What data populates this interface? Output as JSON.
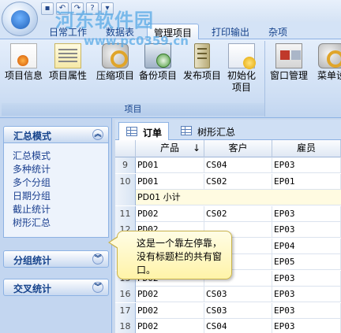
{
  "watermark": {
    "title": "河东软件园",
    "url": "www.pc0359.cn"
  },
  "ribbon_tabs": [
    {
      "label": "日常工作"
    },
    {
      "label": "数据表"
    },
    {
      "label": "管理项目"
    },
    {
      "label": "打印输出"
    },
    {
      "label": "杂项"
    }
  ],
  "ribbon_groups": [
    {
      "label": "项目"
    }
  ],
  "ribbon_buttons": [
    {
      "label": "项目信息",
      "icon": "certificate-icon"
    },
    {
      "label": "项目属性",
      "icon": "notepad-icon"
    },
    {
      "label": "压缩项目",
      "icon": "tools-icon"
    },
    {
      "label": "备份项目",
      "icon": "backup-disk-icon"
    },
    {
      "label": "发布项目",
      "icon": "server-icon"
    },
    {
      "label": "初始化项目",
      "icon": "initialize-icon"
    },
    {
      "label": "窗口管理",
      "icon": "window-icon"
    },
    {
      "label": "菜单设",
      "icon": "menu-settings-icon"
    }
  ],
  "nav": {
    "summary_header": "汇总模式",
    "summary_links": [
      "汇总模式",
      "多种统计",
      "多个分组",
      "日期分组",
      "截止统计",
      "树形汇总"
    ],
    "group_header": "分组统计",
    "cross_header": "交叉统计"
  },
  "doc_tabs": [
    {
      "label": "订单"
    },
    {
      "label": "树形汇总"
    }
  ],
  "grid": {
    "columns": [
      "产品",
      "客户",
      "雇员"
    ],
    "rows": [
      {
        "num": "9",
        "cells": [
          "PD01",
          "CS04",
          "EP03"
        ]
      },
      {
        "num": "10",
        "cells": [
          "PD01",
          "CS02",
          "EP01"
        ]
      },
      {
        "num": "",
        "subtotal": "PD01 小计"
      },
      {
        "num": "11",
        "cells": [
          "PD02",
          "CS02",
          "EP03"
        ]
      },
      {
        "num": "12",
        "cells": [
          "PD02",
          "",
          "EP03"
        ]
      },
      {
        "num": "13",
        "cells": [
          "PD02",
          "",
          "EP04"
        ]
      },
      {
        "num": "14",
        "cells": [
          "PD02",
          "",
          "EP05"
        ]
      },
      {
        "num": "15",
        "cells": [
          "PD02",
          "",
          "EP03"
        ]
      },
      {
        "num": "16",
        "cells": [
          "PD02",
          "CS03",
          "EP03"
        ]
      },
      {
        "num": "17",
        "cells": [
          "PD02",
          "CS03",
          "EP03"
        ]
      },
      {
        "num": "18",
        "cells": [
          "PD02",
          "CS04",
          "EP03"
        ]
      }
    ]
  },
  "callout": {
    "text": "这是一个靠左停靠，没有标题栏的共有窗口。"
  }
}
